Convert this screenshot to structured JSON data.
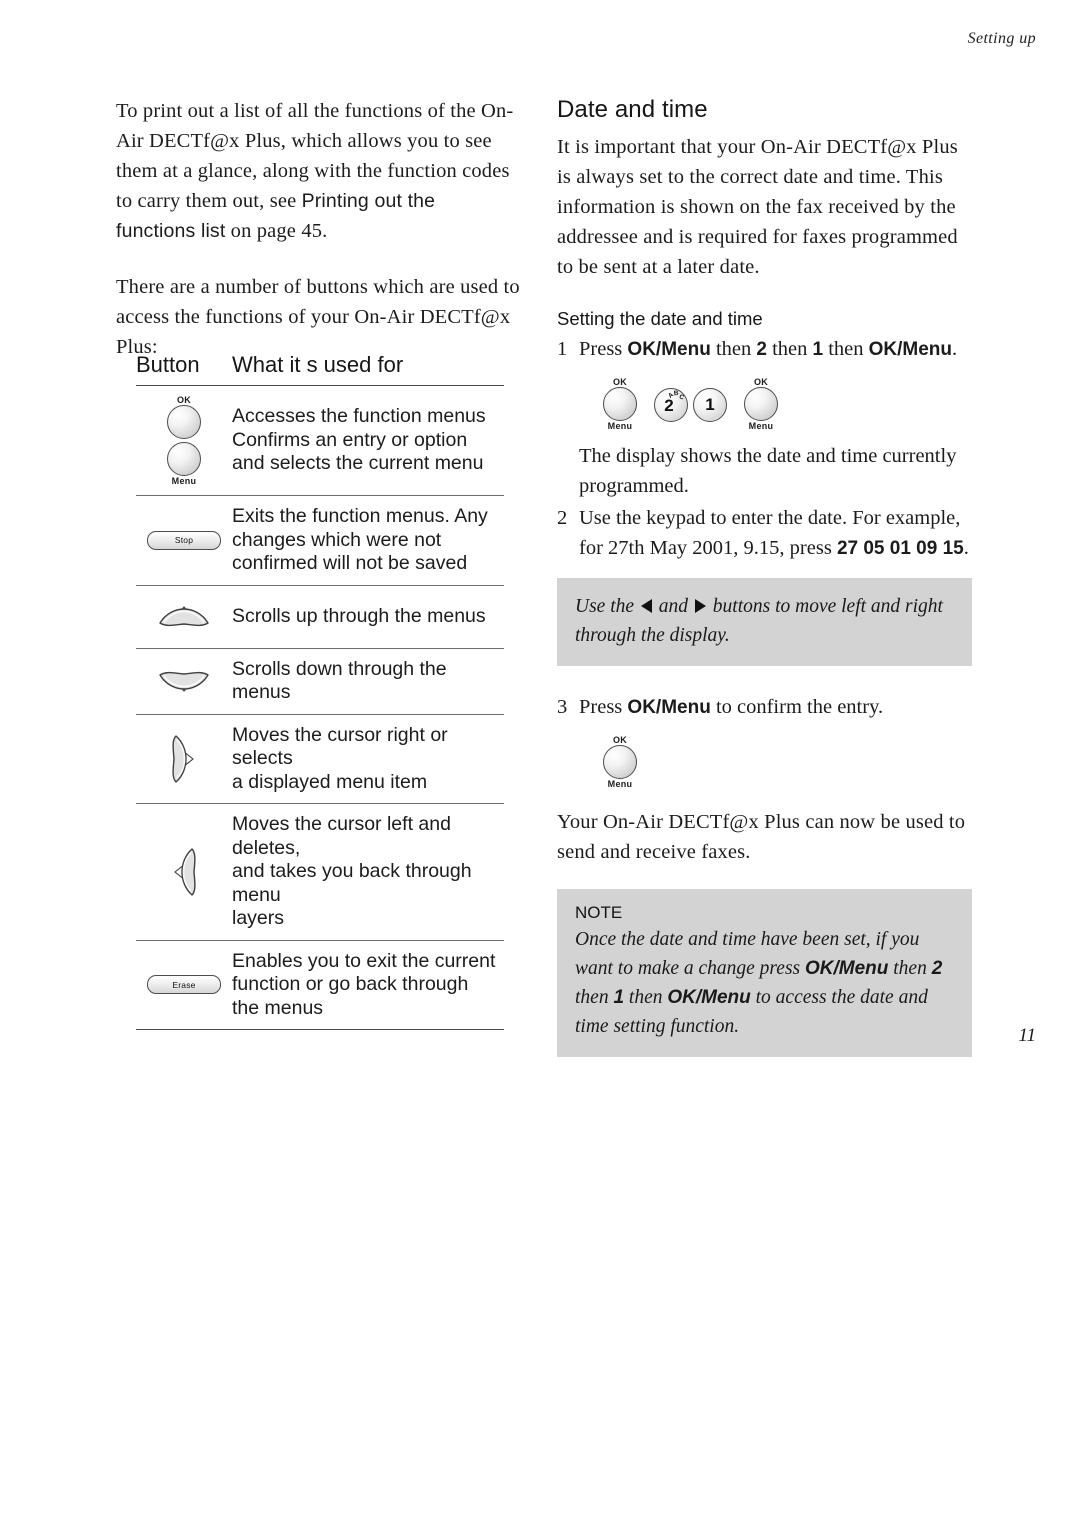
{
  "header": {
    "running_head": "Setting up"
  },
  "folio": {
    "page_number": "11"
  },
  "left_column": {
    "paragraphs": [
      {
        "before": "To print out a list of all the functions of the On-Air DECTf@x Plus, which allows you to see them at a glance, along with the function codes to carry them out, see ",
        "emphasis": "Printing out the functions list",
        "after": " on page 45."
      },
      {
        "before": "There are a number of buttons which are used to access the functions of your On-Air DECTf@x Plus:",
        "emphasis": "",
        "after": ""
      }
    ],
    "table": {
      "col1_header": "Button",
      "col2_header": "What it s used for",
      "rows": [
        {
          "button_type": "ok-menu-stack",
          "button_labels": {
            "top": "OK",
            "bottom": "Menu"
          },
          "lines": [
            "Accesses the function menus",
            "Confirms an entry or option",
            "and selects the current menu"
          ]
        },
        {
          "button_type": "oblong",
          "button_labels": {
            "text": "Stop"
          },
          "lines": [
            "Exits the function menus. Any",
            "changes which were not",
            "confirmed will not be saved"
          ]
        },
        {
          "button_type": "rocker-up",
          "button_labels": {},
          "lines": [
            "Scrolls up through the menus"
          ]
        },
        {
          "button_type": "rocker-down",
          "button_labels": {},
          "lines": [
            "Scrolls down through the menus"
          ]
        },
        {
          "button_type": "rocker-right",
          "button_labels": {},
          "lines": [
            "Moves the cursor right or selects",
            "a displayed menu item"
          ]
        },
        {
          "button_type": "rocker-left",
          "button_labels": {},
          "lines": [
            "Moves the cursor left and deletes,",
            "and takes you back through menu",
            "layers"
          ]
        },
        {
          "button_type": "oblong",
          "button_labels": {
            "text": "Erase"
          },
          "lines": [
            "Enables you to exit the current",
            "function or go back through",
            "the menus"
          ]
        }
      ]
    }
  },
  "right_column": {
    "section_heading": "Date and time",
    "intro": "It is important that your On-Air DECTf@x Plus is always set to the correct date and time. This information is shown on the fax received by the addressee and is required for faxes programmed to be sent at a later date.",
    "subheading": "Setting the date and time",
    "step1": {
      "number": "1",
      "t1": "Press ",
      "b1": "OK/Menu",
      "t2": " then ",
      "b2": "2",
      "t3": " then ",
      "b3": "1",
      "t4": " then ",
      "b4": "OK/Menu",
      "t5": "."
    },
    "step1_keys": [
      {
        "type": "ok-menu",
        "top": "OK",
        "bottom": "Menu"
      },
      {
        "type": "number",
        "digit": "2",
        "letters": "ABC"
      },
      {
        "type": "number",
        "digit": "1",
        "letters": ""
      },
      {
        "type": "ok-menu",
        "top": "OK",
        "bottom": "Menu"
      }
    ],
    "step1_result": "The display shows the date and time currently programmed.",
    "step2": {
      "number": "2",
      "t1": "Use the keypad to enter the date. For example, for 27th May 2001, 9.15, press ",
      "b1": "27 05 01 09 15",
      "t2": "."
    },
    "tip_box": {
      "t1": "Use the ",
      "icon1": "triangle-left",
      "t2": " and ",
      "icon2": "triangle-right",
      "t3": " buttons to move left and right through the display."
    },
    "step3": {
      "number": "3",
      "t1": "Press ",
      "b1": "OK/Menu",
      "t2": " to confirm the entry."
    },
    "step3_keys": [
      {
        "type": "ok-menu",
        "top": "OK",
        "bottom": "Menu"
      }
    ],
    "closing": "Your On-Air DECTf@x Plus can now be used to send and receive faxes.",
    "note_box": {
      "label": "NOTE",
      "t1": "Once the date and time have been set, if you want to make a change press ",
      "b1": "OK/Menu",
      "t2": " then ",
      "b2": "2",
      "t3": " then ",
      "b3": "1",
      "t4": " then ",
      "b4": "OK/Menu",
      "t5": " to access the date and time setting function."
    }
  },
  "colors": {
    "page_background": "#ffffff",
    "text": "#1a1a1a",
    "tint_box": "#d3d3d3",
    "rule": "#4a4a4a"
  }
}
